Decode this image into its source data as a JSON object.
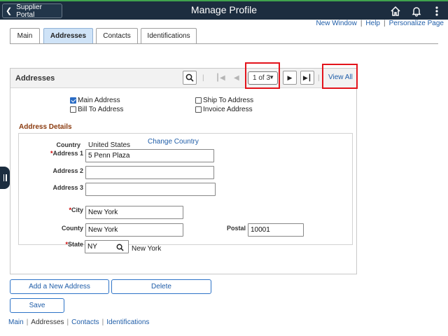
{
  "header": {
    "back_label": "Supplier Portal",
    "title": "Manage Profile",
    "icons": [
      "home-icon",
      "bell-icon",
      "more-vertical-icon"
    ]
  },
  "top_links": {
    "new_window": "New Window",
    "help": "Help",
    "personalize": "Personalize Page",
    "sep": "|"
  },
  "tabs": [
    {
      "label": "Main",
      "active": false
    },
    {
      "label": "Addresses",
      "active": true
    },
    {
      "label": "Contacts",
      "active": false
    },
    {
      "label": "Identifications",
      "active": false
    }
  ],
  "panel": {
    "title": "Addresses",
    "pager": "1 of 3",
    "view_all": "View All",
    "sep": "|"
  },
  "address_types": {
    "main": {
      "label": "Main Address",
      "checked": true
    },
    "bill": {
      "label": "Bill To Address",
      "checked": false
    },
    "ship": {
      "label": "Ship To Address",
      "checked": false
    },
    "invoice": {
      "label": "Invoice Address",
      "checked": false
    }
  },
  "details": {
    "section_title": "Address Details",
    "country_label": "Country",
    "country_value": "United States",
    "change_country": "Change Country",
    "required_mark": "*",
    "address1_label": "Address 1",
    "address1_value": "5 Penn Plaza",
    "address2_label": "Address 2",
    "address2_value": "",
    "address3_label": "Address 3",
    "address3_value": "",
    "city_label": "City",
    "city_value": "New York",
    "county_label": "County",
    "county_value": "New York",
    "postal_label": "Postal",
    "postal_value": "10001",
    "state_label": "State",
    "state_value": "NY",
    "state_desc": "New York"
  },
  "buttons": {
    "add": "Add a New Address",
    "delete": "Delete",
    "save": "Save"
  },
  "footer_nav": {
    "main": "Main",
    "addresses": "Addresses",
    "contacts": "Contacts",
    "identifications": "Identifications",
    "sep": "|"
  },
  "colors": {
    "header_bg": "#1c2d3f",
    "header_accent": "#3fa34d",
    "link": "#1f5da8",
    "highlight_box": "#e3141c",
    "section_title": "#8a3a0e"
  }
}
